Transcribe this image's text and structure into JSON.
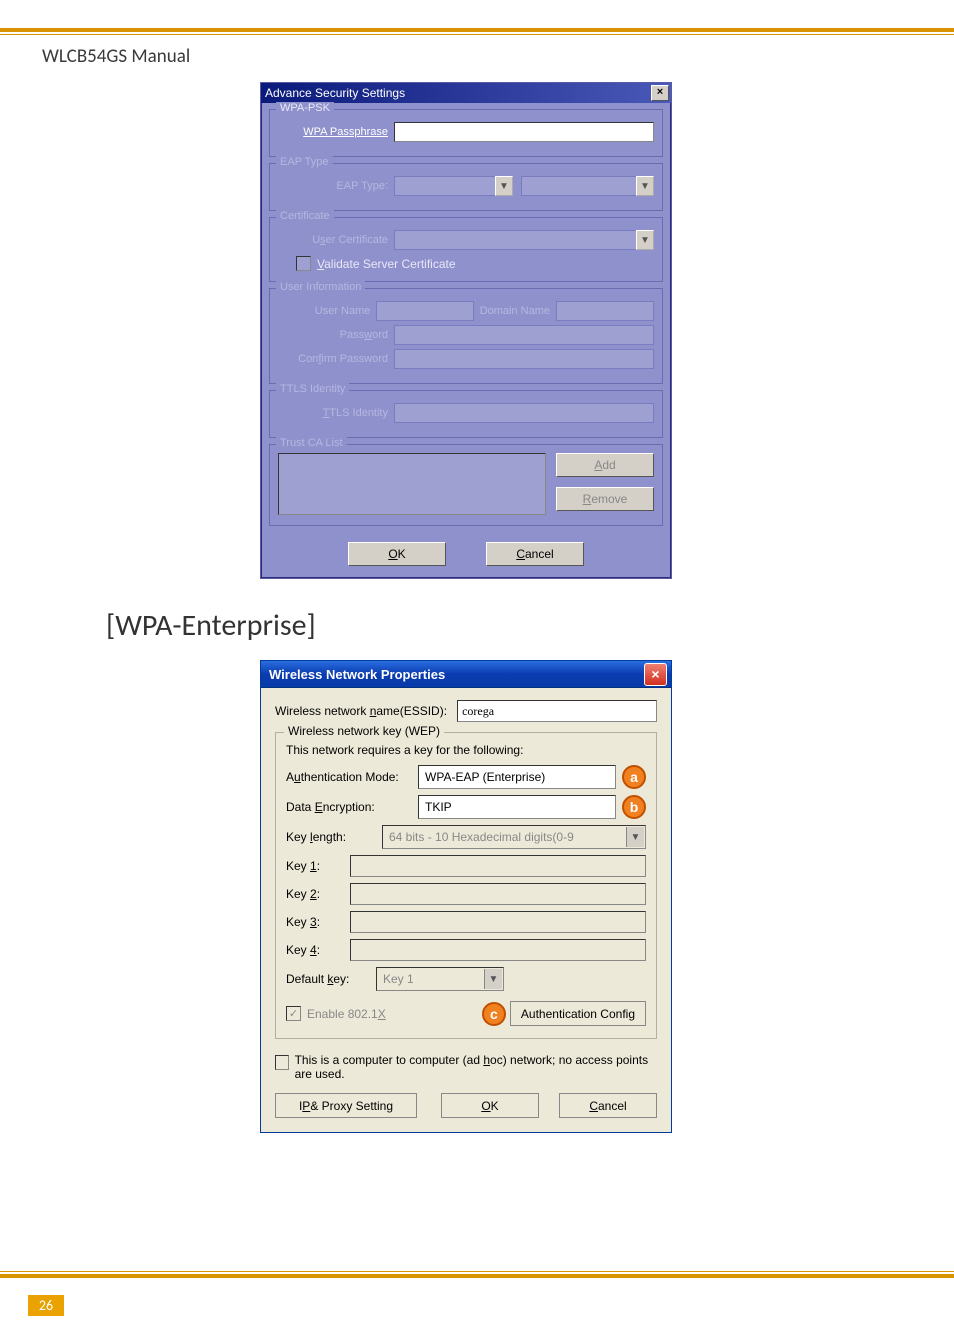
{
  "doc": {
    "header": "WLCB54GS Manual",
    "section_heading": "[WPA-Enterprise]",
    "page_number": "26"
  },
  "win1": {
    "title": "Advance Security Settings",
    "groups": {
      "wpapsk": {
        "legend": "WPA-PSK",
        "passphrase_label": "WPA Passphrase"
      },
      "eap": {
        "legend": "EAP Type",
        "label": "EAP Type:"
      },
      "cert": {
        "legend": "Certificate",
        "user_cert_label": "User Certificate",
        "validate_label": "Validate Server Certificate"
      },
      "userinfo": {
        "legend": "User Information",
        "username_label": "User Name",
        "domain_label": "Domain Name",
        "password_label": "Password",
        "confirm_label": "Confirm Password"
      },
      "ttls": {
        "legend": "TTLS Identity",
        "label": "TTLS Identity"
      },
      "trustca": {
        "legend": "Trust CA List",
        "add": "Add",
        "remove": "Remove"
      }
    },
    "buttons": {
      "ok": "OK",
      "cancel": "Cancel"
    }
  },
  "win2": {
    "title": "Wireless Network Properties",
    "essid": {
      "label": "Wireless network name(ESSID):",
      "value": "corega"
    },
    "wep": {
      "legend": "Wireless network key (WEP)",
      "desc": "This network requires a key for the following:",
      "auth_label": "Authentication Mode:",
      "auth_value": "WPA-EAP (Enterprise)",
      "enc_label": "Data Encryption:",
      "enc_value": "TKIP",
      "keylen_label": "Key length:",
      "keylen_value": "64 bits - 10 Hexadecimal digits(0-9",
      "key1": "Key 1:",
      "key2": "Key 2:",
      "key3": "Key 3:",
      "key4": "Key 4:",
      "default_key_label": "Default key:",
      "default_key_value": "Key 1",
      "enable8021x": "Enable 802.1X",
      "auth_config_btn": "Authentication Config"
    },
    "adhoc": "This is a computer to computer (ad hoc) network; no access points are used.",
    "buttons": {
      "ipproxy": "IP & Proxy Setting",
      "ok": "OK",
      "cancel": "Cancel"
    },
    "callouts": {
      "a": "a",
      "b": "b",
      "c": "c"
    }
  }
}
